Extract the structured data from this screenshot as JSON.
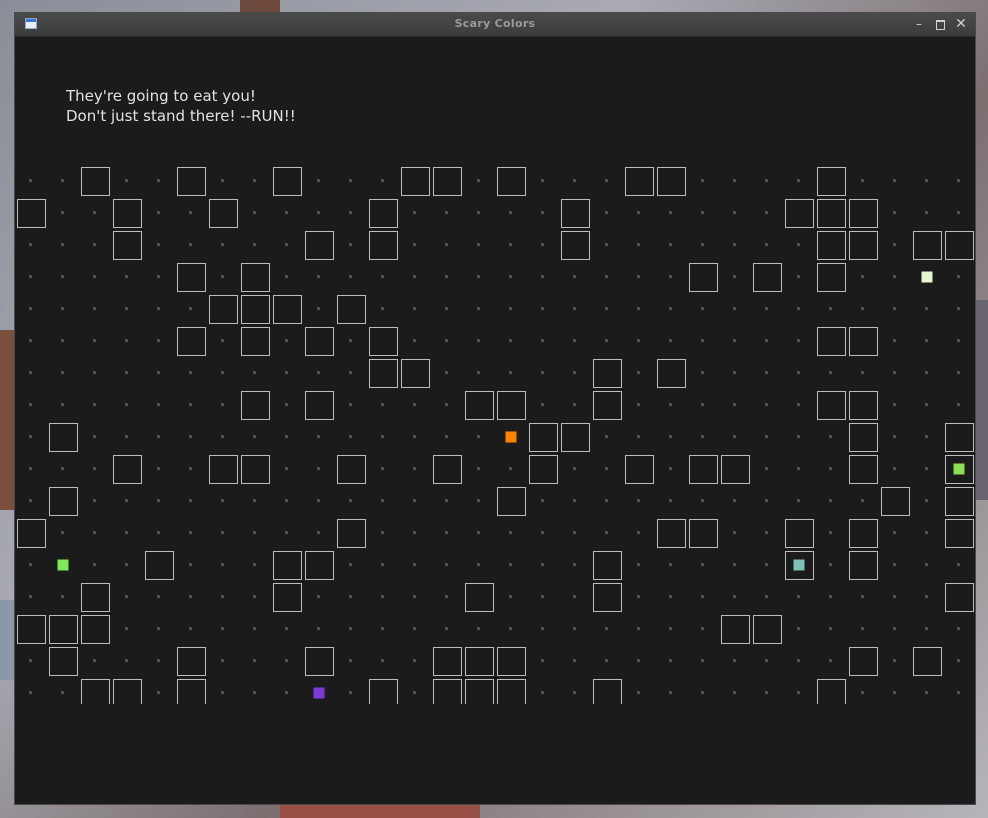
{
  "window": {
    "title": "Scary Colors"
  },
  "message": {
    "line1": "They're going to eat you!",
    "line2": "Don't just stand there! --RUN!!"
  },
  "colors": {
    "background": "#1b1b1b",
    "wall_outline": "#bdbdbd",
    "dot": "#555555",
    "player": "#ff8200",
    "ghost_cream": "#e4f7d2",
    "ghost_lime": "#8ce052",
    "ghost_green": "#7ce85a",
    "ghost_teal": "#7fc2b4",
    "ghost_purple": "#7b3ad6"
  },
  "board": {
    "cols": 30,
    "rows": 18,
    "map": [
      "..#..#..#...##.#...##....#....#..",
      "#..#..#....#.....#......###......",
      "...#.....#.#.....#.......##.##...",
      ".....#.#.............#.#.#.....#.",
      "......###.#...................#..",
      ".....#.#.#.#.............##...#..",
      "...........##.....#.#.........#..",
      ".......#.#....##..#......##...#.#",
      ".#..............##........#..#..##",
      "...#..##..#..#..#..#.##...#..##...",
      ".#.............#...........#.#..#.#",
      "#.........#.........##..#.#..#.#...",
      "....#...##........#.....#.#.......",
      "..#.....#.....#...#..........#....",
      "###...................##..........",
      ".#...#...#...###..........#.#.....",
      "..##.#.....#.###..#......#......#",
      "...##.......#..............#.##..."
    ],
    "entities": [
      {
        "kind": "player",
        "col": 15,
        "row": 8,
        "color": "#ff8200"
      },
      {
        "kind": "ghost",
        "col": 28,
        "row": 3,
        "color": "#e4f7d2"
      },
      {
        "kind": "ghost",
        "col": 29,
        "row": 9,
        "color": "#8ce052"
      },
      {
        "kind": "ghost",
        "col": 1,
        "row": 12,
        "color": "#7ce85a"
      },
      {
        "kind": "ghost",
        "col": 24,
        "row": 12,
        "color": "#7fc2b4"
      },
      {
        "kind": "ghost",
        "col": 9,
        "row": 16,
        "color": "#7b3ad6"
      }
    ]
  }
}
